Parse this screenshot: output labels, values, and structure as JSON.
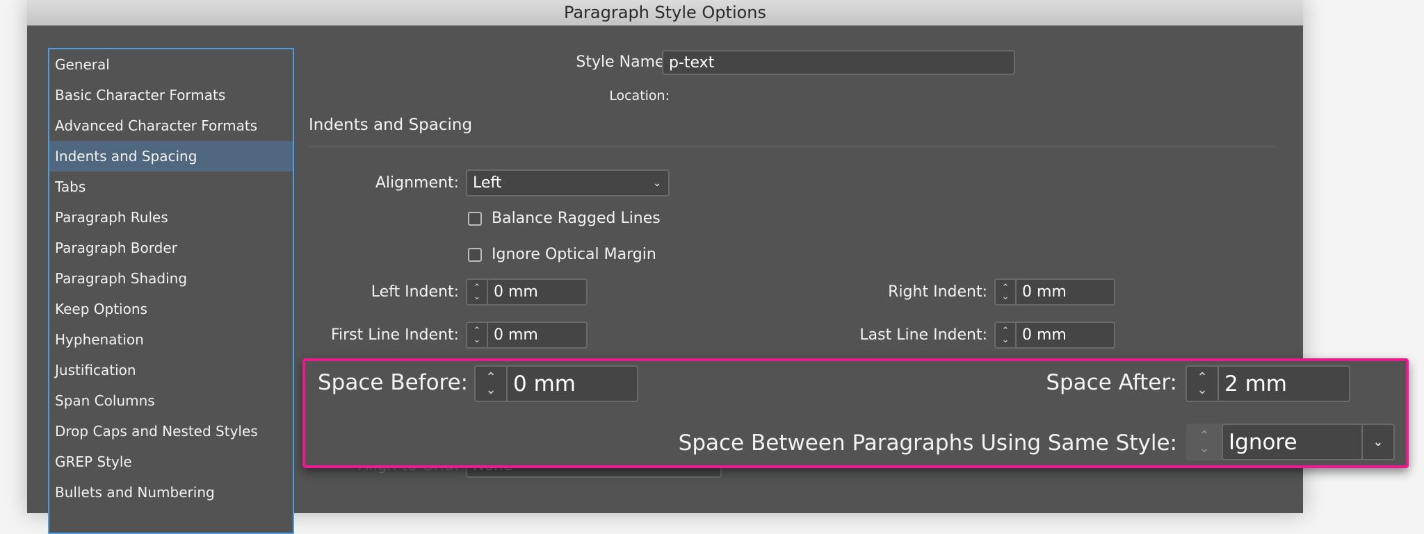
{
  "window": {
    "title": "Paragraph Style Options"
  },
  "sidebar": {
    "items": [
      {
        "label": "General"
      },
      {
        "label": "Basic Character Formats"
      },
      {
        "label": "Advanced Character Formats"
      },
      {
        "label": "Indents and Spacing",
        "selected": true
      },
      {
        "label": "Tabs"
      },
      {
        "label": "Paragraph Rules"
      },
      {
        "label": "Paragraph Border"
      },
      {
        "label": "Paragraph Shading"
      },
      {
        "label": "Keep Options"
      },
      {
        "label": "Hyphenation"
      },
      {
        "label": "Justification"
      },
      {
        "label": "Span Columns"
      },
      {
        "label": "Drop Caps and Nested Styles"
      },
      {
        "label": "GREP Style"
      },
      {
        "label": "Bullets and Numbering"
      }
    ]
  },
  "header": {
    "style_name_label": "Style Name:",
    "style_name_value": "p-text",
    "location_label": "Location:",
    "section_title": "Indents and Spacing"
  },
  "form": {
    "alignment_label": "Alignment:",
    "alignment_value": "Left",
    "balance_ragged_label": "Balance Ragged Lines",
    "balance_ragged_checked": false,
    "ignore_optical_label": "Ignore Optical Margin",
    "ignore_optical_checked": false,
    "left_indent_label": "Left Indent:",
    "left_indent_value": "0 mm",
    "right_indent_label": "Right Indent:",
    "right_indent_value": "0 mm",
    "first_line_label": "First Line Indent:",
    "first_line_value": "0 mm",
    "last_line_label": "Last Line Indent:",
    "last_line_value": "0 mm",
    "align_grid_label": "Align to Grid:",
    "align_grid_value": "None"
  },
  "highlight": {
    "color": "#ec1a8c",
    "space_before_label": "Space Before:",
    "space_before_value": "0 mm",
    "space_after_label": "Space After:",
    "space_after_value": "2 mm",
    "space_between_label": "Space Between Paragraphs Using Same Style:",
    "space_between_value": "Ignore"
  }
}
